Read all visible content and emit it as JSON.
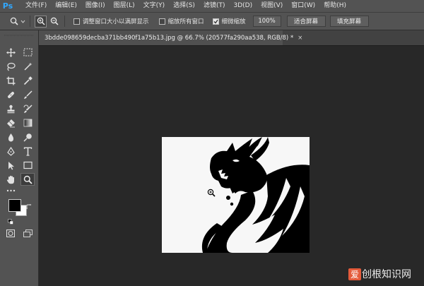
{
  "app": {
    "logo": "Ps",
    "accent_color": "#31a8ff"
  },
  "menu": {
    "items": [
      "文件(F)",
      "编辑(E)",
      "图像(I)",
      "图层(L)",
      "文字(Y)",
      "选择(S)",
      "滤镜(T)",
      "3D(D)",
      "视图(V)",
      "窗口(W)",
      "帮助(H)"
    ]
  },
  "options_bar": {
    "resize_windows_label": "调整窗口大小以满屏显示",
    "resize_windows_checked": false,
    "zoom_all_windows_label": "缩放所有窗口",
    "zoom_all_windows_checked": false,
    "scrubby_zoom_label": "细微缩放",
    "scrubby_zoom_checked": true,
    "zoom_100_label": "100%",
    "fit_screen_label": "适合屏幕",
    "fill_screen_label": "填充屏幕"
  },
  "document": {
    "tab_title": "3bdde098659decba371bb490f1a75b13.jpg @ 66.7% (20577fa290aa538, RGB/8) *",
    "close_glyph": "×"
  },
  "colors": {
    "foreground": "#000000",
    "background": "#ffffff"
  },
  "watermark": {
    "tag": "爱",
    "text": "创根知识网"
  },
  "icons": {
    "tools": [
      "move-icon",
      "marquee-icon",
      "lasso-icon",
      "magic-wand-icon",
      "crop-icon",
      "eyedropper-icon",
      "healing-brush-icon",
      "brush-icon",
      "clone-stamp-icon",
      "history-brush-icon",
      "eraser-icon",
      "gradient-icon",
      "blur-icon",
      "dodge-icon",
      "pen-icon",
      "type-icon",
      "path-selection-icon",
      "rectangle-icon",
      "hand-icon",
      "zoom-icon"
    ]
  }
}
